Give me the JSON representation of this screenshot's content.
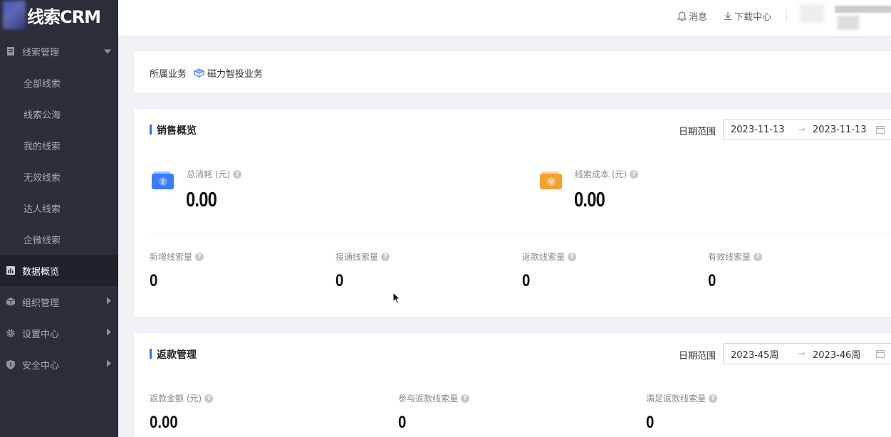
{
  "app": {
    "logo_text": "线索CRM"
  },
  "sidebar": {
    "groups": [
      {
        "label": "线索管理",
        "expanded": true,
        "items": [
          {
            "label": "全部线索"
          },
          {
            "label": "线索公海"
          },
          {
            "label": "我的线索"
          },
          {
            "label": "无效线索"
          },
          {
            "label": "达人线索"
          },
          {
            "label": "企微线索"
          }
        ]
      },
      {
        "label": "数据概览",
        "active": true
      },
      {
        "label": "组织管理"
      },
      {
        "label": "设置中心"
      },
      {
        "label": "安全中心"
      }
    ]
  },
  "header": {
    "messages_label": "消息",
    "download_label": "下载中心"
  },
  "business": {
    "label": "所属业务",
    "value": "磁力智投业务"
  },
  "sales": {
    "title": "销售概览",
    "date_label": "日期范围",
    "date_start": "2023-11-13",
    "date_sep": "→",
    "date_end": "2023-11-13",
    "total_spend_label": "总消耗 (元)",
    "total_spend_value": "0.00",
    "lead_cost_label": "线索成本 (元)",
    "lead_cost_value": "0.00",
    "new_leads_label": "新增线索量",
    "new_leads_value": "0",
    "connected_leads_label": "接通线索量",
    "connected_leads_value": "0",
    "refund_leads_label": "返款线索量",
    "refund_leads_value": "0",
    "valid_leads_label": "有效线索量",
    "valid_leads_value": "0"
  },
  "refund": {
    "title": "返款管理",
    "date_label": "日期范围",
    "date_start": "2023-45周",
    "date_sep": "→",
    "date_end": "2023-46周",
    "amount_label": "返款金额 (元)",
    "amount_value": "0.00",
    "participating_label": "参与返款线索量",
    "participating_value": "0",
    "satisfied_label": "满足返款线索量",
    "satisfied_value": "0"
  },
  "colors": {
    "sidebar_bg": "#2b2f3a",
    "accent": "#2f6bf6",
    "spend_icon": "#3a7bff",
    "cost_icon": "#f5a033"
  }
}
